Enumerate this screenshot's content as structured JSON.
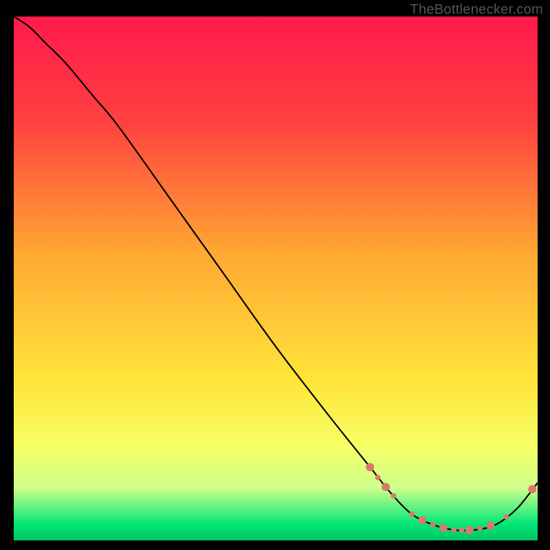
{
  "watermark": "TheBottlenecker.com",
  "chart_data": {
    "type": "line",
    "title": "",
    "xlabel": "",
    "ylabel": "",
    "xlim": [
      0,
      100
    ],
    "ylim": [
      0,
      100
    ],
    "grid": false,
    "legend": false,
    "background_gradient": {
      "stops": [
        {
          "pos": 0.0,
          "color": "#ff1a4b"
        },
        {
          "pos": 0.2,
          "color": "#ff4040"
        },
        {
          "pos": 0.45,
          "color": "#ffa733"
        },
        {
          "pos": 0.7,
          "color": "#ffe63a"
        },
        {
          "pos": 0.82,
          "color": "#f6ff66"
        },
        {
          "pos": 0.9,
          "color": "#cfff8c"
        },
        {
          "pos": 0.97,
          "color": "#00e676"
        },
        {
          "pos": 1.0,
          "color": "#00c566"
        }
      ]
    },
    "series": [
      {
        "name": "bottleneck-curve",
        "color": "#000000",
        "x": [
          0,
          3,
          6,
          10,
          15,
          20,
          30,
          40,
          50,
          60,
          68,
          72,
          76,
          80,
          84,
          88,
          92,
          96,
          100
        ],
        "y": [
          100,
          98,
          95,
          91,
          85,
          79,
          65,
          51,
          37,
          24,
          14,
          9,
          5,
          3,
          2,
          2,
          3,
          6,
          11
        ]
      }
    ],
    "markers": {
      "name": "highlight-points",
      "color": "#d9796e",
      "radius_small": 4,
      "radius_large": 6,
      "points": [
        {
          "x": 68.0,
          "y": 14.0,
          "r": "large"
        },
        {
          "x": 69.5,
          "y": 12.0,
          "r": "small"
        },
        {
          "x": 71.0,
          "y": 10.2,
          "r": "large"
        },
        {
          "x": 72.5,
          "y": 8.5,
          "r": "small"
        },
        {
          "x": 76.0,
          "y": 5.0,
          "r": "small"
        },
        {
          "x": 78.0,
          "y": 3.8,
          "r": "large"
        },
        {
          "x": 80.0,
          "y": 3.0,
          "r": "small"
        },
        {
          "x": 82.0,
          "y": 2.4,
          "r": "large"
        },
        {
          "x": 84.0,
          "y": 2.0,
          "r": "small"
        },
        {
          "x": 85.5,
          "y": 2.0,
          "r": "small"
        },
        {
          "x": 87.0,
          "y": 2.0,
          "r": "large"
        },
        {
          "x": 89.0,
          "y": 2.3,
          "r": "small"
        },
        {
          "x": 91.0,
          "y": 2.8,
          "r": "large"
        },
        {
          "x": 94.0,
          "y": 4.5,
          "r": "small"
        },
        {
          "x": 99.0,
          "y": 9.8,
          "r": "large"
        }
      ]
    }
  }
}
